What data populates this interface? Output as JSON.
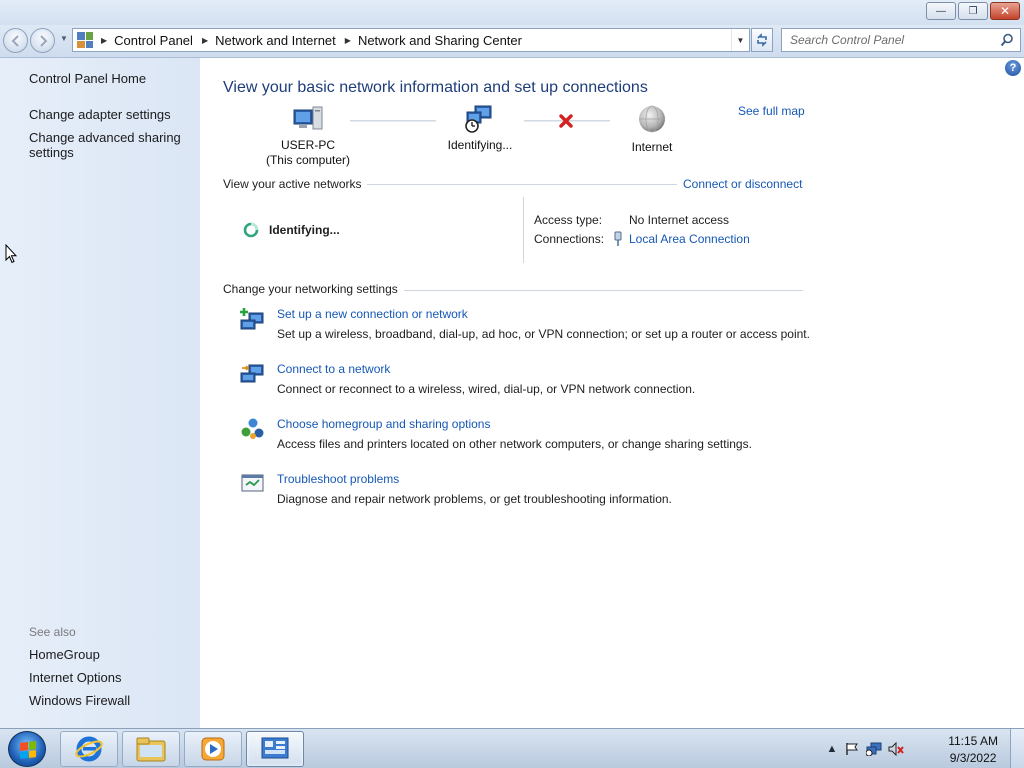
{
  "window": {
    "controls": {
      "minimize": "—",
      "maximize": "❐",
      "close": "✕"
    }
  },
  "nav": {
    "back_icon": "back-arrow-icon",
    "forward_icon": "forward-arrow-icon",
    "breadcrumbs": [
      "Control Panel",
      "Network and Internet",
      "Network and Sharing Center"
    ],
    "search_placeholder": "Search Control Panel"
  },
  "sidebar": {
    "home": "Control Panel Home",
    "links": [
      "Change adapter settings",
      "Change advanced sharing settings"
    ],
    "see_also_label": "See also",
    "see_also": [
      "HomeGroup",
      "Internet Options",
      "Windows Firewall"
    ]
  },
  "main": {
    "title": "View your basic network information and set up connections",
    "see_full_map": "See full map",
    "map": {
      "computer": "USER-PC",
      "computer_sub": "(This computer)",
      "middle": "Identifying...",
      "internet": "Internet"
    },
    "active_networks": {
      "heading": "View your active networks",
      "connect_link": "Connect or disconnect",
      "network_status": "Identifying...",
      "access_type_label": "Access type:",
      "access_type_value": "No Internet access",
      "connections_label": "Connections:",
      "connections_value": "Local Area Connection"
    },
    "settings": {
      "heading": "Change your networking settings",
      "tasks": [
        {
          "title": "Set up a new connection or network",
          "desc": "Set up a wireless, broadband, dial-up, ad hoc, or VPN connection; or set up a router or access point."
        },
        {
          "title": "Connect to a network",
          "desc": "Connect or reconnect to a wireless, wired, dial-up, or VPN network connection."
        },
        {
          "title": "Choose homegroup and sharing options",
          "desc": "Access files and printers located on other network computers, or change sharing settings."
        },
        {
          "title": "Troubleshoot problems",
          "desc": "Diagnose and repair network problems, or get troubleshooting information."
        }
      ]
    }
  },
  "taskbar": {
    "time": "11:15 AM",
    "date": "9/3/2022",
    "pinned": [
      "internet-explorer-icon",
      "file-explorer-icon",
      "media-player-icon",
      "control-panel-icon"
    ],
    "tray": [
      "show-hidden-icons-icon",
      "action-center-flag-icon",
      "network-icon",
      "volume-muted-icon"
    ]
  }
}
